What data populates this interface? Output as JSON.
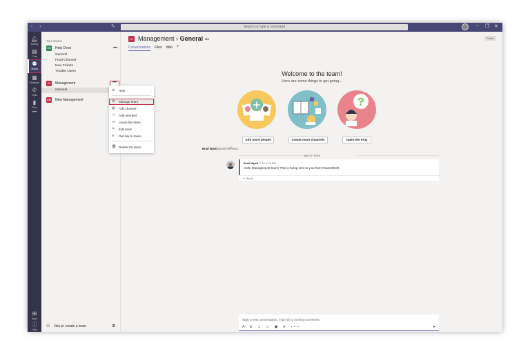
{
  "titlebar": {
    "search_placeholder": "Search or type a command",
    "back_icon": "chevron-left-icon",
    "forward_icon": "chevron-right-icon",
    "compose_icon": "new-chat-icon",
    "minimize": "–",
    "maximize": "❐",
    "close": "✕"
  },
  "appbar": {
    "items": [
      {
        "label": "Activity",
        "icon": "bell-icon"
      },
      {
        "label": "Chat",
        "icon": "chat-icon"
      },
      {
        "label": "Teams",
        "icon": "teams-icon"
      },
      {
        "label": "Meetings",
        "icon": "calendar-icon"
      },
      {
        "label": "Calls",
        "icon": "phone-icon"
      },
      {
        "label": "Files",
        "icon": "file-icon"
      },
      {
        "label": "•••",
        "icon": "more-icon"
      },
      {
        "label": "Apps",
        "icon": "apps-icon"
      },
      {
        "label": "Help",
        "icon": "help-icon"
      }
    ]
  },
  "teams": {
    "section_label": "Your teams",
    "list": [
      {
        "tile": "HD",
        "name": "Help Desk",
        "color": "#2e8b57",
        "channels": [
          "General",
          "Food Channel",
          "New Tickets",
          "Trouble Users"
        ]
      },
      {
        "tile": "M",
        "name": "Management",
        "color": "#c4314b",
        "channels": [
          "General"
        ]
      },
      {
        "tile": "NM",
        "name": "New Management",
        "color": "#c4314b",
        "channels": []
      }
    ],
    "more": "•••",
    "join_label": "Join or create a team"
  },
  "context_menu": {
    "items": [
      {
        "label": "Hide",
        "icon": "hide-icon"
      },
      {
        "label": "Manage team",
        "icon": "gear-icon"
      },
      {
        "label": "Add channel",
        "icon": "add-channel-icon"
      },
      {
        "label": "Add member",
        "icon": "add-member-icon"
      },
      {
        "label": "Leave the team",
        "icon": "leave-icon"
      },
      {
        "label": "Edit team",
        "icon": "pencil-icon"
      },
      {
        "label": "Get link to team",
        "icon": "link-icon"
      },
      {
        "label": "Delete the team",
        "icon": "trash-icon"
      }
    ]
  },
  "main": {
    "team_tile": "M",
    "team": "Management",
    "separator": "›",
    "channel": "General",
    "channel_more": "•••",
    "public_badge": "Public",
    "tabs": [
      {
        "label": "Conversations",
        "active": true
      },
      {
        "label": "Files",
        "active": false
      },
      {
        "label": "Wiki",
        "active": false
      }
    ],
    "add_tab": "+",
    "welcome_title": "Welcome to the team!",
    "welcome_sub": "Here are some things to get going...",
    "cards": [
      {
        "button": "Add more people",
        "color": "#f8c85d"
      },
      {
        "button": "Create more channels",
        "color": "#7fbfc7"
      },
      {
        "button": "Open the FAQ",
        "color": "#e9848d"
      }
    ],
    "system_author": "Brad Wyatt",
    "system_text": " joined the team.",
    "date": "July 17, 2019",
    "message": {
      "author": "Brad Wyatt",
      "time": "7/17 2:29 PM",
      "text": "Hello Management team! This is being sent to you from PowerShell!",
      "reply": "↩ Reply"
    },
    "compose_placeholder": "Start a new conversation. Type @ to mention someone.",
    "compose_tools": "A ⊘ ☺ ▭ ▣ ➤ •••",
    "send_icon": "➤"
  },
  "colors": {
    "brand": "#6264a7",
    "titlebar": "#464775",
    "appbar": "#33344a",
    "highlight": "#c4314b"
  }
}
